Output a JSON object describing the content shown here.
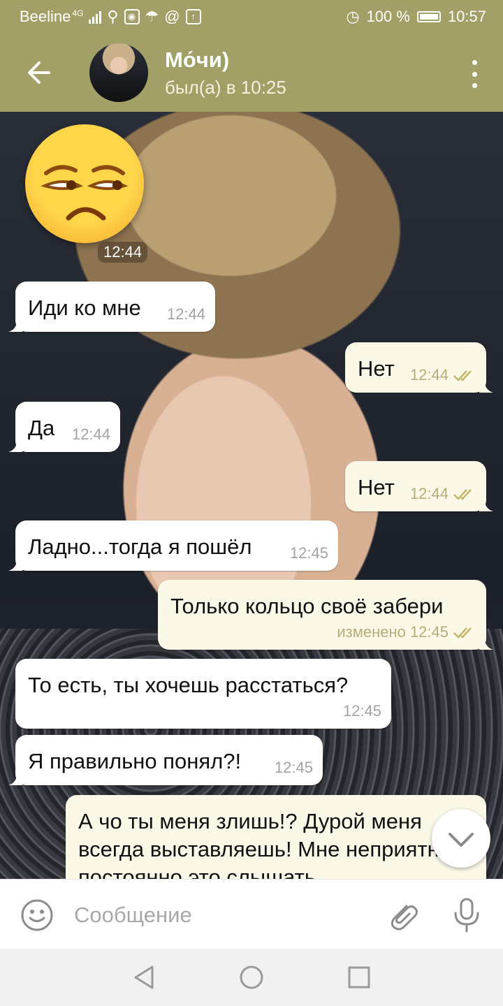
{
  "status_bar": {
    "carrier": "Beeline",
    "network": "4G",
    "battery": "100 %",
    "time": "10:57"
  },
  "header": {
    "name": "Мо́чи)",
    "status": "был(а) в 10:25"
  },
  "sticker": {
    "emoji": "unamused-face",
    "time": "12:44"
  },
  "messages": [
    {
      "dir": "in",
      "text": "Иди ко мне",
      "time": "12:44"
    },
    {
      "dir": "out",
      "text": "Нет",
      "time": "12:44"
    },
    {
      "dir": "in",
      "text": "Да",
      "time": "12:44"
    },
    {
      "dir": "out",
      "text": "Нет",
      "time": "12:44"
    },
    {
      "dir": "in",
      "text": "Ладно...тогда я пошёл",
      "time": "12:45"
    },
    {
      "dir": "out",
      "text": "Только кольцо своё забери",
      "time": "изменено 12:45"
    },
    {
      "dir": "in",
      "text": "То есть, ты хочешь расстаться?",
      "time": "12:45"
    },
    {
      "dir": "in",
      "text": "Я правильно понял?!",
      "time": "12:45"
    },
    {
      "dir": "out",
      "text": "А чо ты меня злишь!? Дурой меня всегда выставляешь! Мне неприятно постоянно это слышать",
      "time": ""
    }
  ],
  "input": {
    "placeholder": "Сообщение"
  }
}
